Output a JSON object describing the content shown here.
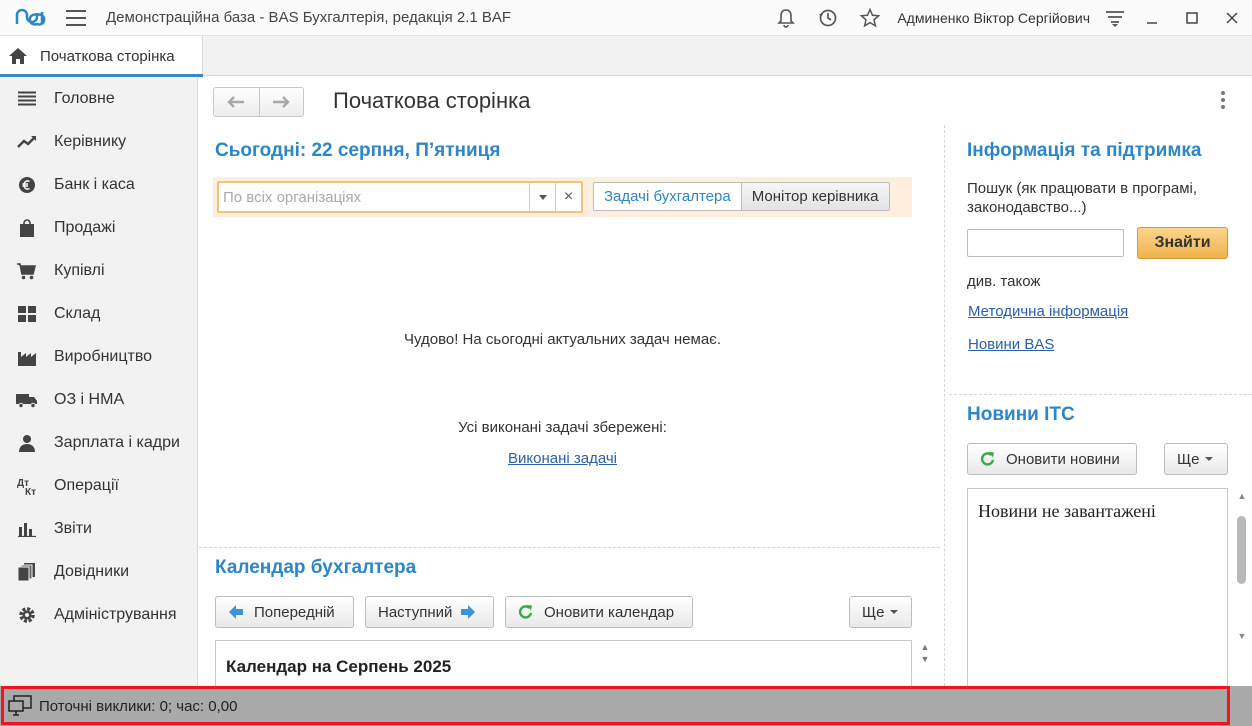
{
  "app": {
    "title": "Демонстраційна база - BAS Бухгалтерія, редакція 2.1 BAF",
    "user": "Админенко Віктор Сергійович"
  },
  "tabs": {
    "home_label": "Початкова сторінка"
  },
  "sidebar": {
    "items": [
      {
        "label": "Головне",
        "icon": "menu-lines-icon"
      },
      {
        "label": "Керівнику",
        "icon": "trend-icon"
      },
      {
        "label": "Банк і каса",
        "icon": "coin-icon"
      },
      {
        "label": "Продажі",
        "icon": "shopping-bag-icon"
      },
      {
        "label": "Купівлі",
        "icon": "cart-icon"
      },
      {
        "label": "Склад",
        "icon": "warehouse-icon"
      },
      {
        "label": "Виробництво",
        "icon": "factory-icon"
      },
      {
        "label": "ОЗ і НМА",
        "icon": "truck-icon"
      },
      {
        "label": "Зарплата і кадри",
        "icon": "person-icon"
      },
      {
        "label": "Операції",
        "icon": "operations-icon"
      },
      {
        "label": "Звіти",
        "icon": "bar-chart-icon"
      },
      {
        "label": "Довідники",
        "icon": "books-icon"
      },
      {
        "label": "Адміністрування",
        "icon": "gear-icon"
      }
    ]
  },
  "main": {
    "page_title": "Початкова сторінка",
    "today": {
      "heading": "Сьогодні: 22 серпня, П’ятниця",
      "org_placeholder": "По всіх організаціях",
      "toggle_active": "Задачі бухгалтера",
      "toggle_inactive": "Монітор керівника",
      "no_tasks": "Чудово! На сьогодні актуальних задач немає.",
      "saved_tasks": "Усі виконані задачі збережені:",
      "done_link": "Виконані задачі"
    },
    "calendar": {
      "heading": "Календар бухгалтера",
      "prev_label": "Попередній",
      "next_label": "Наступний",
      "refresh_label": "Оновити календар",
      "more_label": "Ще",
      "partial_text": "Календар на Серпень 2025"
    }
  },
  "info": {
    "heading": "Інформація та підтримка",
    "search_hint": "Пошук (як працювати в програмі, законодавство...)",
    "search_value": "",
    "find_label": "Знайти",
    "see_also": "див. також",
    "links": [
      "Методична інформація",
      "Новини BAS"
    ]
  },
  "news": {
    "heading": "Новини ІТС",
    "refresh_label": "Оновити новини",
    "more_label": "Ще",
    "empty_text": "Новини не завантажені"
  },
  "status": {
    "text": "Поточні виклики: 0; час: 0,00"
  },
  "colors": {
    "accent": "#2d86c6",
    "link": "#2b5fa8",
    "find_button": "#f0b34e",
    "highlight": "#f0141e"
  }
}
